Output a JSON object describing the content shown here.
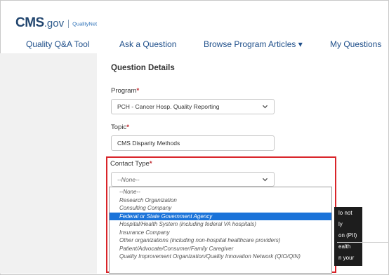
{
  "header": {
    "logo_cms": "CMS",
    "logo_gov": ".gov",
    "logo_qualitynet": "QualityNet"
  },
  "nav": {
    "items": [
      {
        "label": "Quality Q&A Tool"
      },
      {
        "label": "Ask a Question"
      },
      {
        "label": "Browse Program Articles ▾"
      },
      {
        "label": "My Questions"
      }
    ]
  },
  "form": {
    "section_title": "Question Details",
    "program": {
      "label": "Program",
      "required": "*",
      "value": "PCH - Cancer Hosp. Quality Reporting"
    },
    "topic": {
      "label": "Topic",
      "required": "*",
      "value": "CMS Disparity Methods"
    },
    "contact_type": {
      "label": "Contact Type",
      "required": "*",
      "value": "--None--",
      "options": [
        "--None--",
        "Research Organization",
        "Consulting Company",
        "Federal or State Government Agency",
        "Hospital/Health System (including federal VA hospitals)",
        "Insurance Company",
        "Other organizations (including non-hospital healthcare providers)",
        "Patient/Advocate/Consumer/Family Caregiver",
        "Quality Improvement Organization/Quality Innovation Network (QIO/QIN)"
      ],
      "highlighted_option": "Federal or State Government Agency"
    }
  },
  "tooltip": {
    "lines": [
      "lo not",
      "ly",
      "on (PII)",
      "ealth",
      "n your"
    ]
  },
  "colors": {
    "nav_link": "#1f4f8a",
    "required": "#c0272d",
    "highlight_box": "#d9252a",
    "selected_option": "#1a73d9"
  },
  "icons": {
    "select_chevron": "chevron-down-icon"
  }
}
